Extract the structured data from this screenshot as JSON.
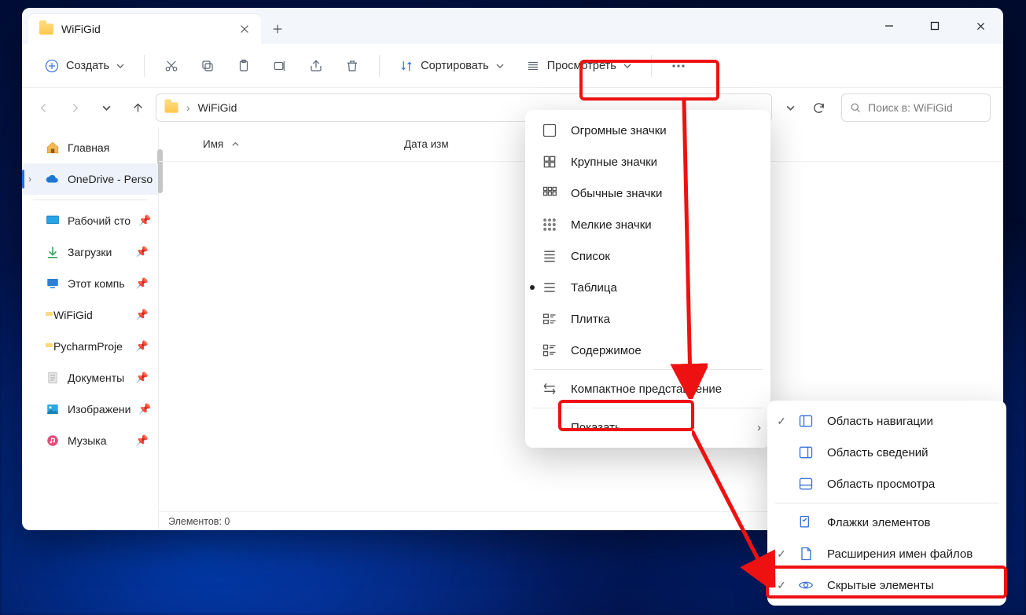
{
  "desktop_hint": "",
  "tab": {
    "title": "WiFiGid"
  },
  "toolbar": {
    "new_label": "Создать",
    "sort_label": "Сортировать",
    "view_label": "Просмотреть"
  },
  "breadcrumb": {
    "folder": "WiFiGid"
  },
  "search": {
    "placeholder": "Поиск в: WiFiGid"
  },
  "sidebar": {
    "items": [
      {
        "label": "Главная",
        "icon": "home"
      },
      {
        "label": "OneDrive - Perso",
        "icon": "cloud",
        "selected": true,
        "expander": true
      },
      {
        "label": "Рабочий сто",
        "icon": "desktop",
        "pinned": true
      },
      {
        "label": "Загрузки",
        "icon": "download",
        "pinned": true
      },
      {
        "label": "Этот компь",
        "icon": "pc",
        "pinned": true
      },
      {
        "label": "WiFiGid",
        "icon": "folder",
        "pinned": true
      },
      {
        "label": "PycharmProje",
        "icon": "folder",
        "pinned": true
      },
      {
        "label": "Документы",
        "icon": "doc",
        "pinned": true
      },
      {
        "label": "Изображени",
        "icon": "image",
        "pinned": true
      },
      {
        "label": "Музыка",
        "icon": "music",
        "pinned": true
      }
    ]
  },
  "columns": {
    "name": "Имя",
    "date": "Дата изм"
  },
  "status": {
    "text": "Элементов: 0"
  },
  "view_menu": {
    "items": [
      {
        "label": "Огромные значки"
      },
      {
        "label": "Крупные значки"
      },
      {
        "label": "Обычные значки"
      },
      {
        "label": "Мелкие значки"
      },
      {
        "label": "Список"
      },
      {
        "label": "Таблица",
        "active": true
      },
      {
        "label": "Плитка"
      },
      {
        "label": "Содержимое"
      },
      {
        "label": "Компактное представление"
      },
      {
        "label": "Показать",
        "submenu": true
      }
    ]
  },
  "show_menu": {
    "items": [
      {
        "label": "Область навигации",
        "checked": true
      },
      {
        "label": "Область сведений"
      },
      {
        "label": "Область просмотра"
      },
      {
        "label": "Флажки элементов"
      },
      {
        "label": "Расширения имен файлов",
        "checked": true
      },
      {
        "label": "Скрытые элементы",
        "checked": true
      }
    ]
  }
}
